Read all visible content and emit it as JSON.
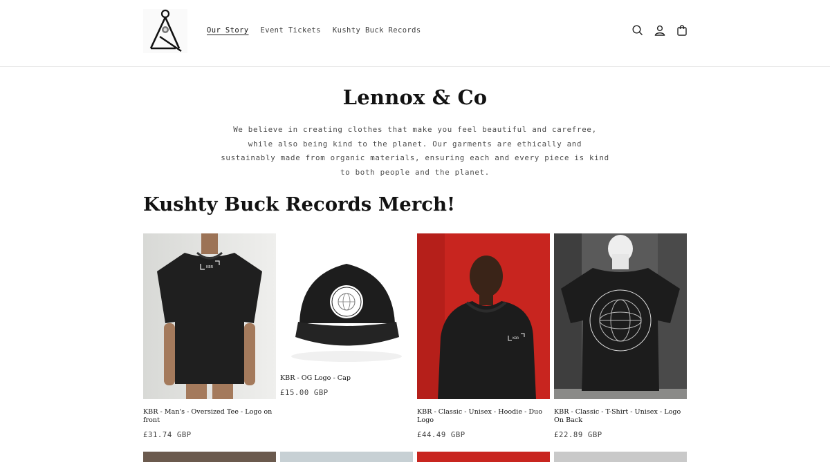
{
  "header": {
    "logo_icon": "triangle-instrument-logo",
    "nav": [
      {
        "label": "Our Story",
        "active": true
      },
      {
        "label": "Event Tickets",
        "active": false
      },
      {
        "label": "Kushty Buck Records",
        "active": false
      }
    ],
    "icons": [
      "search-icon",
      "account-icon",
      "cart-icon"
    ]
  },
  "intro": {
    "title": "Lennox & Co",
    "description": "We believe in creating clothes that make you feel beautiful and carefree, while also being kind to the planet. Our garments are ethically and sustainably made from organic materials, ensuring each and every piece is kind to both people and the planet."
  },
  "collection": {
    "title": "Kushty Buck Records Merch!",
    "products": [
      {
        "name": "KBR - Man's - Oversized Tee - Logo on front",
        "price": "£31.74 GBP"
      },
      {
        "name": "KBR - OG Logo - Cap",
        "price": "£15.00 GBP"
      },
      {
        "name": "KBR - Classic - Unisex - Hoodie - Duo Logo",
        "price": "£44.49 GBP"
      },
      {
        "name": "KBR - Classic - T-Shirt - Unisex - Logo On Back",
        "price": "£22.89 GBP"
      }
    ]
  },
  "colors": {
    "accent": "#121212",
    "hoodie_bg": "#c8251f",
    "garment": "#1c1c1c"
  }
}
